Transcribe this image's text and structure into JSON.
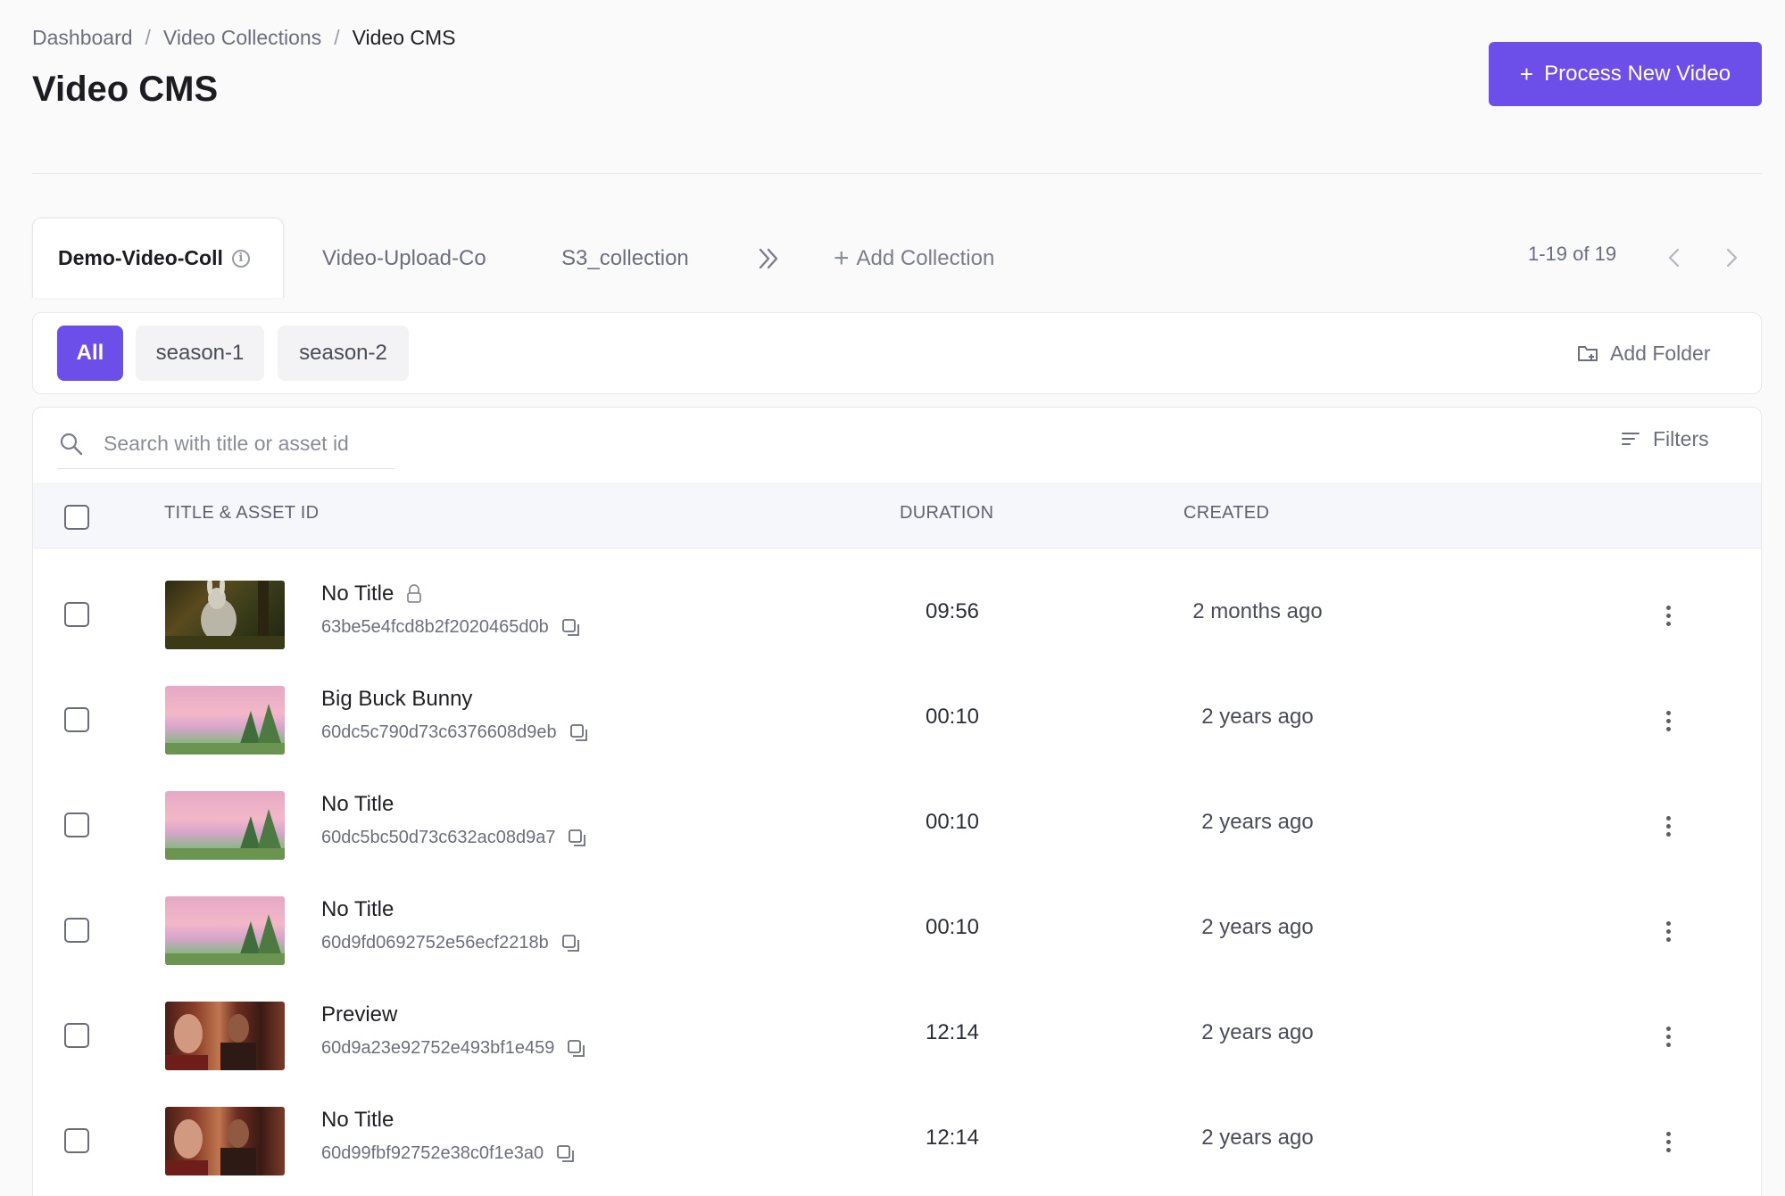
{
  "breadcrumb": {
    "items": [
      "Dashboard",
      "Video Collections"
    ],
    "current": "Video CMS",
    "separator": "/"
  },
  "page": {
    "title": "Video CMS",
    "primary_action": {
      "icon": "plus-icon",
      "label": "Process New Video"
    }
  },
  "collections": {
    "active": {
      "label": "Demo-Video-Coll",
      "icon": "info-icon"
    },
    "tabs": [
      "Video-Upload-Co",
      "S3_collection"
    ],
    "more_icon": "chevrons-right-icon",
    "add_label": "Add Collection"
  },
  "pagination": {
    "text": "1-19 of 19"
  },
  "folders": {
    "chips": [
      "All",
      "season-1",
      "season-2"
    ],
    "active_index": 0,
    "add_label": "Add Folder",
    "add_icon": "folder-plus-icon"
  },
  "search": {
    "placeholder": "Search with title or asset id",
    "value": ""
  },
  "filters": {
    "label": "Filters",
    "icon": "filter-icon"
  },
  "table": {
    "columns": {
      "title": "TITLE & ASSET ID",
      "duration": "DURATION",
      "created": "CREATED"
    },
    "rows": [
      {
        "title": "No Title",
        "locked": true,
        "asset_id": "63be5e4fcd8b2f2020465d0b",
        "duration": "09:56",
        "created": "2 months ago",
        "thumb": "forest"
      },
      {
        "title": "Big Buck Bunny",
        "locked": false,
        "asset_id": "60dc5c790d73c6376608d9eb",
        "duration": "00:10",
        "created": "2 years ago",
        "thumb": "sky"
      },
      {
        "title": "No Title",
        "locked": false,
        "asset_id": "60dc5bc50d73c632ac08d9a7",
        "duration": "00:10",
        "created": "2 years ago",
        "thumb": "sky"
      },
      {
        "title": "No Title",
        "locked": false,
        "asset_id": "60d9fd0692752e56ecf2218b",
        "duration": "00:10",
        "created": "2 years ago",
        "thumb": "sky"
      },
      {
        "title": "Preview",
        "locked": false,
        "asset_id": "60d9a23e92752e493bf1e459",
        "duration": "12:14",
        "created": "2 years ago",
        "thumb": "film"
      },
      {
        "title": "No Title",
        "locked": false,
        "asset_id": "60d99fbf92752e38c0f1e3a0",
        "duration": "12:14",
        "created": "2 years ago",
        "thumb": "film"
      }
    ]
  },
  "colors": {
    "accent": "#6c4ee8",
    "page_bg": "#fafafa",
    "header_row_bg": "#f6f7fb",
    "muted_text": "#6b6f7b"
  }
}
